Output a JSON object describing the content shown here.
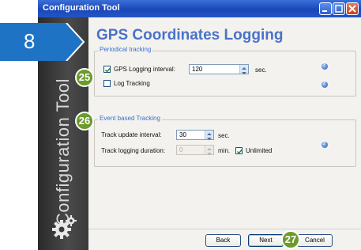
{
  "window": {
    "title": "Configuration Tool"
  },
  "sidebar": {
    "label": "Configuration Tool"
  },
  "page": {
    "title": "GPS Coordinates Logging"
  },
  "periodical": {
    "legend": "Periodical tracking",
    "gps_interval_label": "GPS Logging interval:",
    "gps_interval_value": "120",
    "gps_interval_unit": "sec.",
    "gps_interval_checked": true,
    "log_tracking_label": "Log Tracking",
    "log_tracking_checked": false
  },
  "event": {
    "legend": "Event based Tracking",
    "update_interval_label": "Track update interval:",
    "update_interval_value": "30",
    "update_interval_unit": "sec.",
    "duration_label": "Track logging duration:",
    "duration_value": "0",
    "duration_unit": "min.",
    "unlimited_label": "Unlimited",
    "unlimited_checked": true
  },
  "buttons": {
    "back": "Back",
    "next": "Next",
    "cancel": "Cancel"
  },
  "annotations": {
    "step": "8",
    "badge_periodical": "25",
    "badge_event": "26",
    "badge_next": "27"
  },
  "colors": {
    "title_blue": "#4a72c9",
    "step_blue": "#1f73c4",
    "badge_green": "#6b9b2b"
  }
}
